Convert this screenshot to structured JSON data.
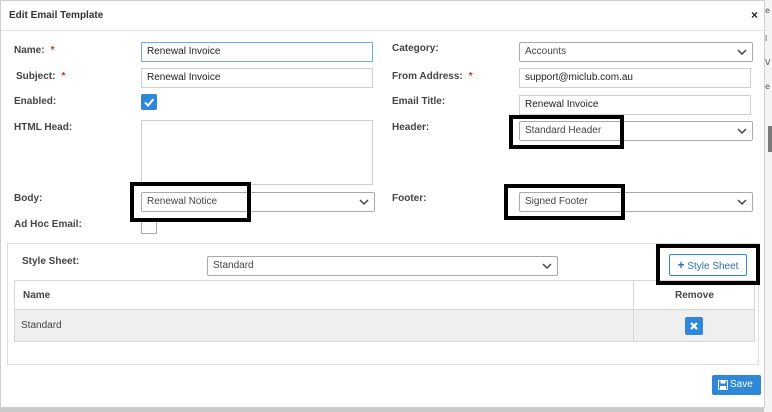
{
  "modal": {
    "title": "Edit Email Template",
    "close_label": "×"
  },
  "form": {
    "name": {
      "label": "Name:",
      "required_mark": "*",
      "value": "Renewal Invoice"
    },
    "subject": {
      "label": "Subject:",
      "required_mark": "*",
      "value": "Renewal Invoice"
    },
    "enabled": {
      "label": "Enabled:",
      "checked": true
    },
    "html_head": {
      "label": "HTML Head:",
      "value": ""
    },
    "body": {
      "label": "Body:",
      "value": "Renewal Notice"
    },
    "ad_hoc": {
      "label": "Ad Hoc Email:",
      "checked": false
    },
    "category": {
      "label": "Category:",
      "value": "Accounts"
    },
    "from_address": {
      "label": "From Address:",
      "required_mark": "*",
      "value": "support@miclub.com.au"
    },
    "email_title": {
      "label": "Email Title:",
      "value": "Renewal Invoice"
    },
    "header": {
      "label": "Header:",
      "value": "Standard Header"
    },
    "footer": {
      "label": "Footer:",
      "value": "Signed Footer"
    }
  },
  "stylesheet": {
    "label": "Style Sheet:",
    "value": "Standard",
    "add_button_label": "Style Sheet",
    "columns": {
      "name": "Name",
      "remove": "Remove"
    },
    "rows": [
      {
        "name": "Standard"
      }
    ]
  },
  "footer_actions": {
    "save_label": "Save"
  },
  "colors": {
    "primary": "#2f87d8",
    "required": "#c0392b",
    "highlight_border": "#000000"
  },
  "icons": {
    "close": "close-icon",
    "chevron": "chevron-down-icon",
    "check": "check-icon",
    "plus": "plus-icon",
    "remove": "times-icon",
    "save": "floppy-disk-icon"
  }
}
